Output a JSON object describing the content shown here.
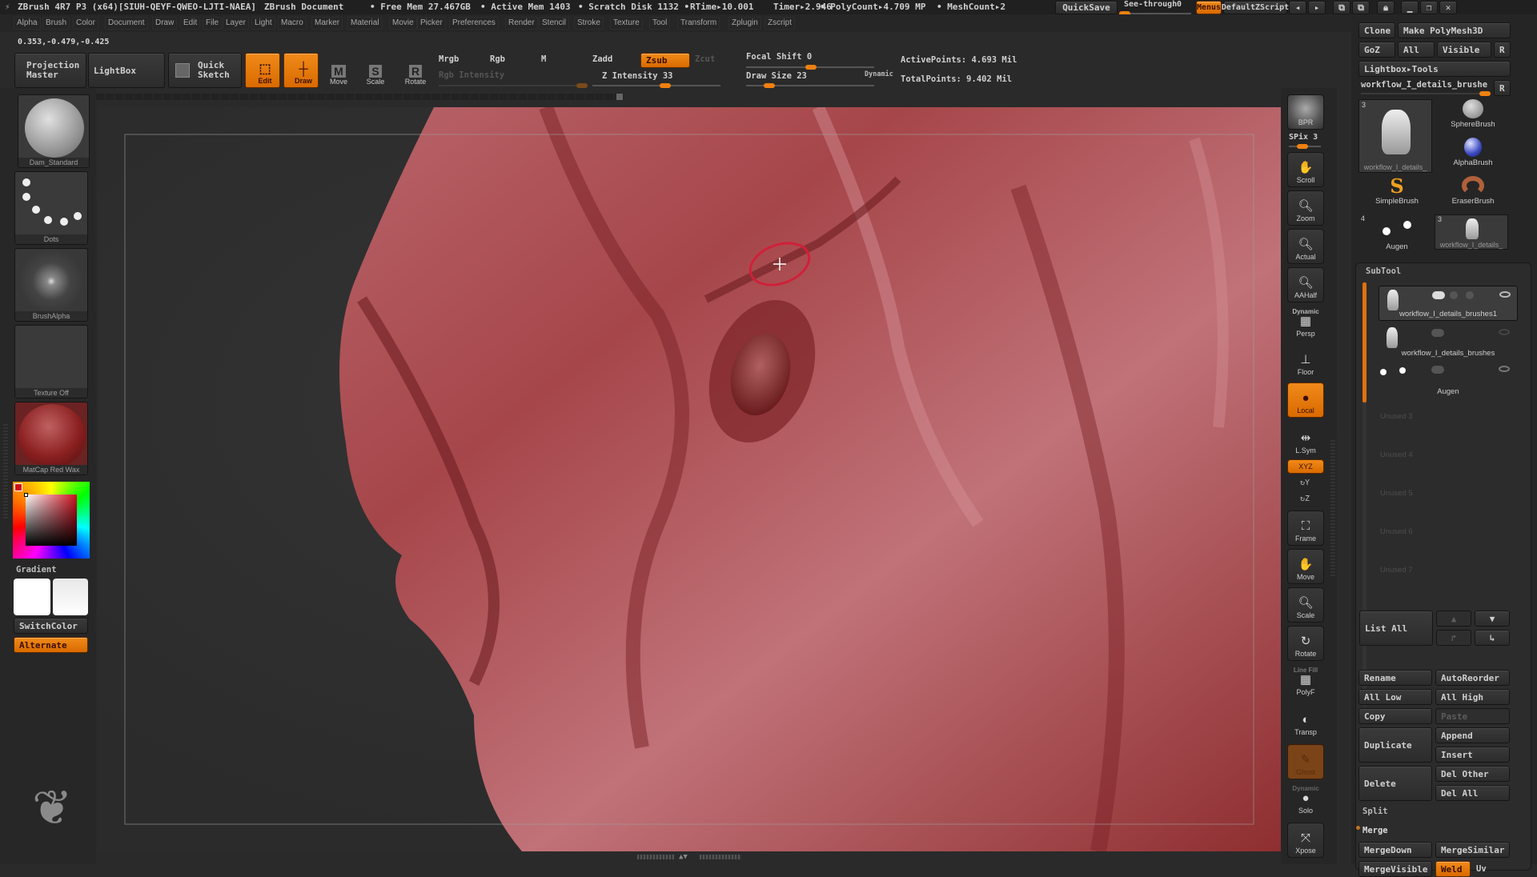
{
  "titlebar": {
    "app_title": "ZBrush 4R7 P3 (x64)[SIUH-QEYF-QWEO-LJTI-NAEA]",
    "document": "ZBrush Document",
    "free_mem": "• Free Mem 27.467GB",
    "active_mem": "• Active Mem 1403",
    "scratch_disk": "• Scratch Disk 1132 •",
    "rtime": "RTime▸10.001",
    "timer": "Timer▸2.946",
    "polycount": "• PolyCount▸4.709 MP",
    "meshcount": "• MeshCount▸2",
    "quicksave": "QuickSave",
    "see_through_label": "See-through",
    "see_through_value": "0",
    "menus": "Menus",
    "default_zscript": "DefaultZScript"
  },
  "menubar": {
    "items": [
      "Alpha",
      "Brush",
      "Color",
      "Document",
      "Draw",
      "Edit",
      "File",
      "Layer",
      "Light",
      "Macro",
      "Marker",
      "Material",
      "Movie",
      "Picker",
      "Preferences",
      "Render",
      "Stencil",
      "Stroke",
      "Texture",
      "Tool",
      "Transform",
      "Zplugin",
      "Zscript"
    ]
  },
  "coords": "0.353,-0.479,-0.425",
  "toolbar": {
    "projection_master": "Projection Master",
    "lightbox": "LightBox",
    "quick_sketch": "Quick Sketch",
    "edit": "Edit",
    "draw": "Draw",
    "move": "Move",
    "scale": "Scale",
    "rotate": "Rotate",
    "mrgb": "Mrgb",
    "rgb": "Rgb",
    "m": "M",
    "rgb_intensity": "Rgb Intensity",
    "zadd": "Zadd",
    "zsub": "Zsub",
    "zcut": "Zcut",
    "z_intensity": "Z Intensity 33",
    "z_intensity_value": 33,
    "focal_shift": "Focal Shift 0",
    "focal_shift_value": 0,
    "draw_size": "Draw Size 23",
    "draw_size_value": 23,
    "dynamic": "Dynamic",
    "active_points": "ActivePoints: 4.693 Mil",
    "total_points": "TotalPoints: 9.402 Mil"
  },
  "leftpanel": {
    "brush": "Dam_Standard",
    "stroke": "Dots",
    "alpha": "BrushAlpha",
    "texture": "Texture Off",
    "material": "MatCap Red Wax",
    "gradient": "Gradient",
    "switch_color": "SwitchColor",
    "alternate": "Alternate",
    "main_color": "#d01010"
  },
  "rightshelf": {
    "bpr": "BPR",
    "spix": "SPix 3",
    "scroll": "Scroll",
    "zoom": "Zoom",
    "actual": "Actual",
    "aahalf": "AAHalf",
    "dynamic": "Dynamic",
    "persp": "Persp",
    "floor": "Floor",
    "local": "Local",
    "lsym": "L.Sym",
    "xyz": "XYZ",
    "y": "Y",
    "z": "Z",
    "frame": "Frame",
    "move": "Move",
    "scale": "Scale",
    "rotate": "Rotate",
    "line_fill": "Line Fill",
    "polyf": "PolyF",
    "transp": "Transp",
    "ghost": "Ghost",
    "dynamic2": "Dynamic",
    "solo": "Solo",
    "xpose": "Xpose"
  },
  "toolpanel": {
    "clone": "Clone",
    "make_polymesh": "Make PolyMesh3D",
    "goz": "GoZ",
    "all": "All",
    "visible": "Visible",
    "r": "R",
    "lightbox_tools": "Lightbox▸Tools",
    "current_tool": "workflow_I_details_brushe",
    "tools": [
      {
        "name": "workflow_I_details_",
        "count": "3"
      },
      {
        "name": "SphereBrush"
      },
      {
        "name": "AlphaBrush"
      },
      {
        "name": "SimpleBrush"
      },
      {
        "name": "EraserBrush"
      },
      {
        "name": "Augen",
        "count": "4"
      },
      {
        "name": "workflow_I_details_",
        "count": "3"
      }
    ]
  },
  "subtool": {
    "title": "SubTool",
    "items": [
      {
        "name": "workflow_I_details_brushes1",
        "selected": true
      },
      {
        "name": "workflow_I_details_brushes",
        "selected": false
      },
      {
        "name": "Augen",
        "selected": false
      }
    ],
    "unused": [
      "Unused 3",
      "Unused 4",
      "Unused 5",
      "Unused 6",
      "Unused 7"
    ],
    "list_all": "List All",
    "rename": "Rename",
    "autoreorder": "AutoReorder",
    "all_low": "All Low",
    "all_high": "All High",
    "copy": "Copy",
    "paste": "Paste",
    "duplicate": "Duplicate",
    "append": "Append",
    "insert": "Insert",
    "delete": "Delete",
    "del_other": "Del Other",
    "del_all": "Del All",
    "split": "Split",
    "merge": "Merge",
    "merge_down": "MergeDown",
    "merge_similar": "MergeSimilar",
    "merge_visible": "MergeVisible",
    "weld": "Weld",
    "uv": "Uv"
  }
}
